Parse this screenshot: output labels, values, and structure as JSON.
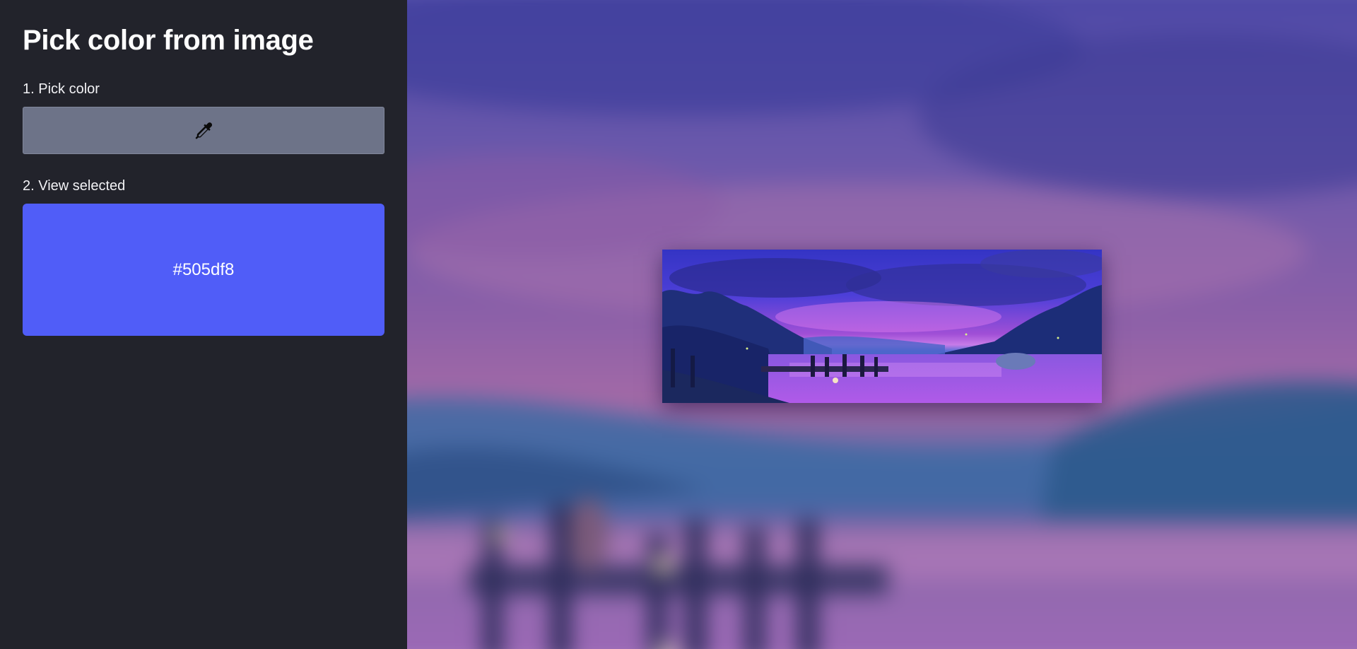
{
  "sidebar": {
    "title": "Pick color from image",
    "step1_label": "1. Pick color",
    "picker_icon": "eyedropper-icon",
    "step2_label": "2. View selected"
  },
  "selected": {
    "hex": "#505df8",
    "color": "#505df8"
  },
  "colors": {
    "sidebar_bg": "#22232b",
    "picker_button_bg": "#6d7388",
    "accent": "#505df8"
  },
  "image": {
    "subject": "lakeside pier at dusk with purple sky"
  }
}
